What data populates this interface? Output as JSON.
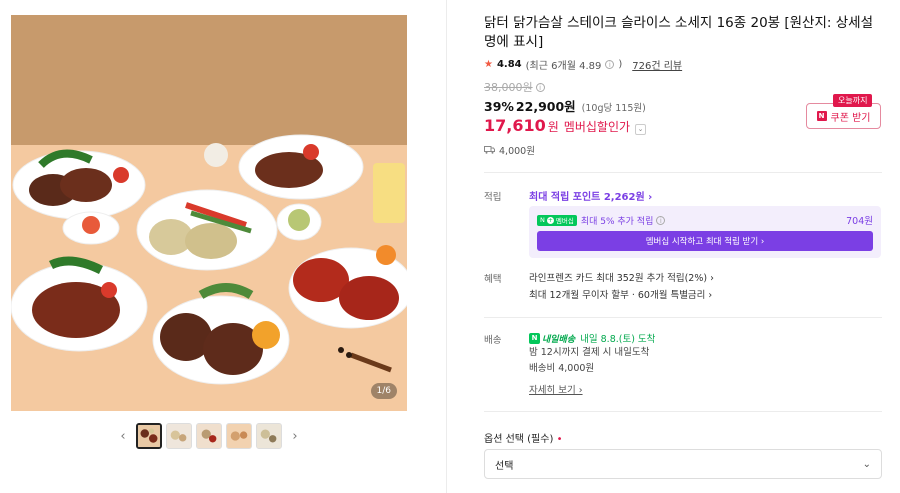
{
  "gallery": {
    "counter": "1/6",
    "prev_arrow": "‹",
    "next_arrow": "›",
    "thumb_count": 5
  },
  "product": {
    "title": "닭터 닭가슴살 스테이크 슬라이스 소세지 16종 20봉 [원산지: 상세설명에 표시]",
    "rating": "4.84",
    "recent_rating": "(최근 6개월 4.89",
    "recent_rating_close": ")",
    "reviews": "726건 리뷰",
    "original_price": "38,000원",
    "discount_rate": "39%",
    "sale_price": "22,900원",
    "unit_price": "(10g당 115원)",
    "member_price": "17,610",
    "member_won": "원",
    "member_label": "멤버십할인가",
    "coupon_badge": "오늘까지",
    "coupon_button": "쿠폰 받기",
    "delivery_fee": "4,000원"
  },
  "points": {
    "label": "적립",
    "max_points": "최대 적립 포인트 2,262원 ›",
    "np_label": "N",
    "np_membership": "멤버십",
    "extra_rate": "최대 5% 추가 적립",
    "extra_amount": "704원",
    "membership_button": "멤버십 시작하고 최대 적립 받기 ›"
  },
  "benefit": {
    "label": "혜택",
    "line1": "라인프렌즈 카드 최대 352원 추가 적립(2%) ›",
    "line2": "최대 12개월 무이자 할부 · 60개월 특별금리 ›"
  },
  "shipping": {
    "label": "배송",
    "badge": "내일배송",
    "arrival": "내일 8.8.(토) 도착",
    "line1": "밤 12시까지 결제 시 내일도착",
    "line2": "배송비 4,000원",
    "details_link": "자세히 보기 ›"
  },
  "options": {
    "label": "옵션 선택 (필수)",
    "required_mark": "•",
    "select_value": "선택"
  },
  "colors": {
    "accent_red": "#e0184c",
    "points_purple": "#7b3fe4",
    "naver_green": "#03c75a"
  }
}
